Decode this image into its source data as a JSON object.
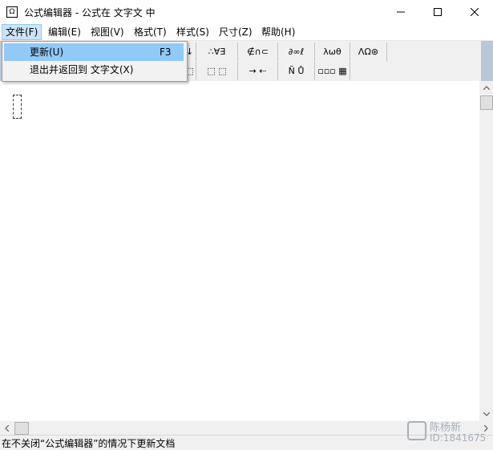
{
  "window": {
    "title": "公式编辑器 - 公式在 文字文 中",
    "app_icon": "equation-icon",
    "app_icon_glyph": "Ω"
  },
  "menu": [
    {
      "label": "文件(F)"
    },
    {
      "label": "编辑(E)"
    },
    {
      "label": "视图(V)"
    },
    {
      "label": "格式(T)"
    },
    {
      "label": "样式(S)"
    },
    {
      "label": "尺寸(Z)"
    },
    {
      "label": "帮助(H)"
    }
  ],
  "file_menu": {
    "items": [
      {
        "label": "更新(U)",
        "shortcut": "F3"
      },
      {
        "label": "退出并返回到 文字文(X)",
        "shortcut": ""
      }
    ]
  },
  "palette": {
    "row1": [
      "↓",
      "∴∀∃",
      "∉∩⊂",
      "∂∞ℓ",
      "λωθ",
      "ΛΩ⊛"
    ],
    "row2": [
      "⬚",
      "⬚ ⬚",
      "→ ⇠",
      "Ñ Ů",
      "▫▫▫ ▦"
    ]
  },
  "status": {
    "text": "在不关闭“公式编辑器”的情况下更新文档"
  },
  "watermark": {
    "name": "陈杨新",
    "id": "ID:1841675"
  },
  "colors": {
    "toolbar_bg": "#b9c8d9",
    "menu_highlight": "#91c9f7"
  }
}
